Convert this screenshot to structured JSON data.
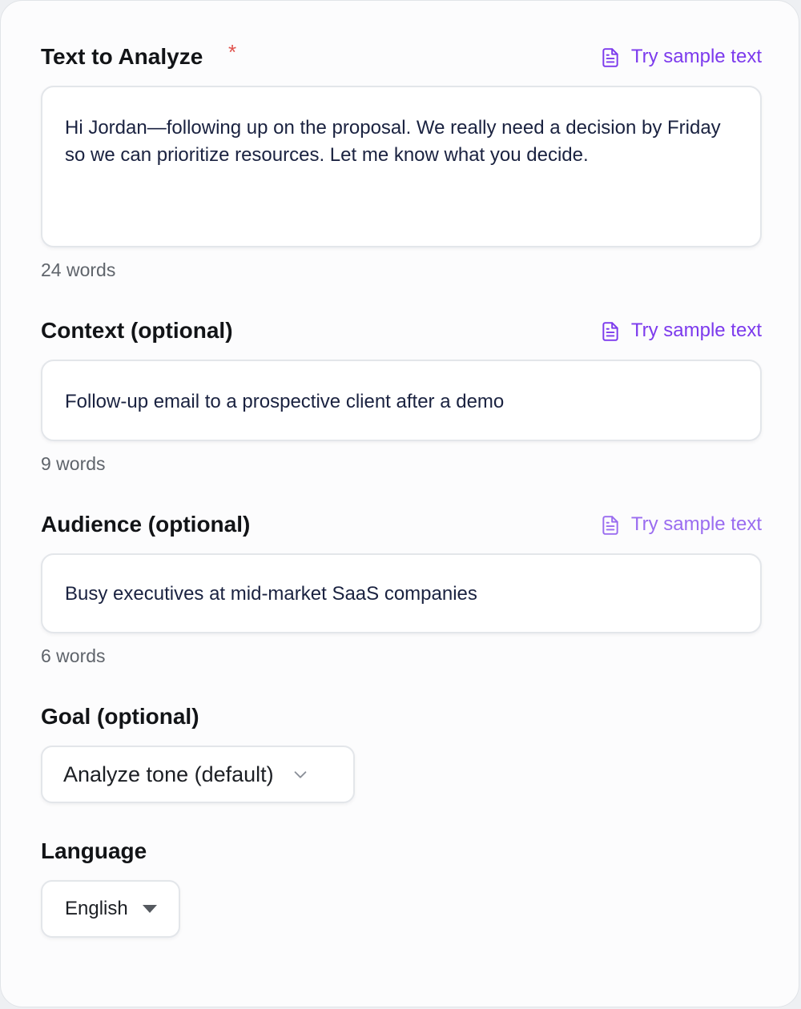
{
  "fields": {
    "text": {
      "label": "Text to Analyze",
      "required_mark": "*",
      "sample_label": "Try sample text",
      "value": "Hi Jordan—following up on the proposal. We really need a decision by Friday so we can prioritize resources. Let me know what you decide.",
      "word_count": "24 words"
    },
    "context": {
      "label": "Context (optional)",
      "sample_label": "Try sample text",
      "value": "Follow-up email to a prospective client after a demo",
      "word_count": "9 words"
    },
    "audience": {
      "label": "Audience (optional)",
      "sample_label": "Try sample text",
      "value": "Busy executives at mid-market SaaS companies",
      "word_count": "6 words"
    },
    "goal": {
      "label": "Goal (optional)",
      "selected": "Analyze tone (default)"
    },
    "language": {
      "label": "Language",
      "selected": "English"
    }
  },
  "icons": {
    "sample": "document-icon",
    "goal_dropdown": "chevron-down-icon",
    "language_dropdown": "caret-down-icon"
  },
  "colors": {
    "accent": "#7c3aed",
    "required": "#e0524d",
    "input_text": "#1a2240",
    "muted": "#5f646b"
  }
}
